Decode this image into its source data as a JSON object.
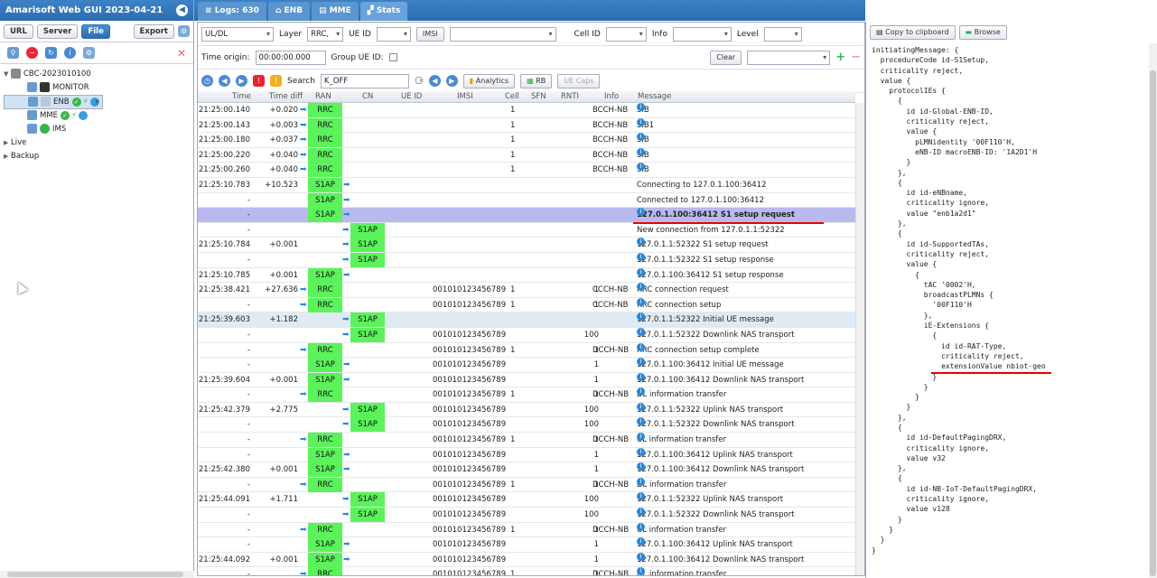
{
  "app": {
    "title": "Amarisoft Web GUI 2023-04-21"
  },
  "sidebar": {
    "buttons": [
      "URL",
      "Server",
      "File",
      "Export"
    ],
    "tree": {
      "root": "CBC-2023010100",
      "items": [
        {
          "label": "MONITOR"
        },
        {
          "label": "ENB"
        },
        {
          "label": "MME"
        },
        {
          "label": "IMS"
        }
      ],
      "live": "Live",
      "backup": "Backup"
    }
  },
  "tabs": [
    {
      "label": "Logs: 630"
    },
    {
      "label": "ENB"
    },
    {
      "label": "MME"
    },
    {
      "label": "Stats"
    }
  ],
  "filters": {
    "uldl": "UL/DL",
    "layer_label": "Layer",
    "layer_value": "RRC,",
    "ueid_label": "UE ID",
    "imsi_btn": "IMSI",
    "cellid_label": "Cell ID",
    "info_label": "Info",
    "level_label": "Level",
    "time_origin_label": "Time origin:",
    "time_origin_value": "00:00:00.000",
    "group_ueid_label": "Group UE ID:",
    "clear_label": "Clear",
    "search_label": "Search",
    "search_value": "K_OFF",
    "analytics_label": "Analytics",
    "rb_label": "RB",
    "uecaps_label": "UE Caps"
  },
  "table": {
    "headers": [
      "Time",
      "Time diff",
      "RAN",
      "CN",
      "UE ID",
      "IMSI",
      "Cell",
      "SFN",
      "RNTI",
      "Info",
      "Message"
    ],
    "rows": [
      {
        "time": "21:25:00.140",
        "diff": "+0.020",
        "ran": "RRC",
        "cn": "",
        "ueid": "",
        "imsi": "",
        "cell": "1",
        "info": "BCCH-NB",
        "msg": "SIB",
        "i": true
      },
      {
        "time": "21:25:00.143",
        "diff": "+0.003",
        "ran": "RRC",
        "cn": "",
        "ueid": "",
        "imsi": "",
        "cell": "1",
        "info": "BCCH-NB",
        "msg": "SIB1",
        "i": true
      },
      {
        "time": "21:25:00.180",
        "diff": "+0.037",
        "ran": "RRC",
        "cn": "",
        "ueid": "",
        "imsi": "",
        "cell": "1",
        "info": "BCCH-NB",
        "msg": "SIB",
        "i": true
      },
      {
        "time": "21:25:00.220",
        "diff": "+0.040",
        "ran": "RRC",
        "cn": "",
        "ueid": "",
        "imsi": "",
        "cell": "1",
        "info": "BCCH-NB",
        "msg": "SIB",
        "i": true
      },
      {
        "time": "21:25:00.260",
        "diff": "+0.040",
        "ran": "RRC",
        "cn": "",
        "ueid": "",
        "imsi": "",
        "cell": "1",
        "info": "BCCH-NB",
        "msg": "SIB",
        "i": true
      },
      {
        "time": "21:25:10.783",
        "diff": "+10.523",
        "ran": "S1AP",
        "cn": "",
        "ueid": "",
        "imsi": "",
        "cell": "",
        "info": "",
        "msg": "Connecting to 127.0.1.100:36412",
        "i": false
      },
      {
        "time": "-",
        "diff": "",
        "ran": "S1AP",
        "cn": "",
        "ueid": "",
        "imsi": "",
        "cell": "",
        "info": "",
        "msg": "Connected to 127.0.1.100:36412",
        "i": false
      },
      {
        "time": "-",
        "diff": "",
        "ran": "S1AP",
        "cn": "",
        "ueid": "",
        "imsi": "",
        "cell": "",
        "info": "",
        "msg": "127.0.1.100:36412 S1 setup request",
        "i": true,
        "hl": true
      },
      {
        "time": "-",
        "diff": "",
        "ran": "",
        "cn": "S1AP",
        "ueid": "",
        "imsi": "",
        "cell": "",
        "info": "",
        "msg": "New connection from 127.0.1.1:52322",
        "i": false
      },
      {
        "time": "21:25:10.784",
        "diff": "+0.001",
        "ran": "",
        "cn": "S1AP",
        "ueid": "",
        "imsi": "",
        "cell": "",
        "info": "",
        "msg": "127.0.1.1:52322 S1 setup request",
        "i": true
      },
      {
        "time": "-",
        "diff": "",
        "ran": "",
        "cn": "S1AP",
        "ueid": "",
        "imsi": "",
        "cell": "",
        "info": "",
        "msg": "127.0.1.1:52322 S1 setup response",
        "i": true
      },
      {
        "time": "21:25:10.785",
        "diff": "+0.001",
        "ran": "S1AP",
        "cn": "",
        "ueid": "",
        "imsi": "",
        "cell": "",
        "info": "",
        "msg": "127.0.1.100:36412 S1 setup response",
        "i": true
      },
      {
        "time": "21:25:38.421",
        "diff": "+27.636",
        "ran": "RRC",
        "cn": "",
        "ueid": "1",
        "imsi": "001010123456789",
        "cell": "1",
        "info": "CCCH-NB",
        "msg": "RRC connection request",
        "i": true
      },
      {
        "time": "-",
        "diff": "",
        "ran": "RRC",
        "cn": "",
        "ueid": "1",
        "imsi": "001010123456789",
        "cell": "1",
        "info": "CCCH-NB",
        "msg": "RRC connection setup",
        "i": true
      },
      {
        "time": "21:25:39.603",
        "diff": "+1.182",
        "ran": "",
        "cn": "S1AP",
        "ueid": "",
        "imsi": "",
        "cell": "",
        "info": "",
        "msg": "127.0.1.1:52322 Initial UE message",
        "i": true,
        "hl2": true
      },
      {
        "time": "-",
        "diff": "",
        "ran": "",
        "cn": "S1AP",
        "ueid": "100",
        "imsi": "001010123456789",
        "cell": "",
        "info": "",
        "msg": "127.0.1.1:52322 Downlink NAS transport",
        "i": true
      },
      {
        "time": "-",
        "diff": "",
        "ran": "RRC",
        "cn": "",
        "ueid": "1",
        "imsi": "001010123456789",
        "cell": "1",
        "info": "DCCH-NB",
        "msg": "RRC connection setup complete",
        "i": true
      },
      {
        "time": "-",
        "diff": "",
        "ran": "S1AP",
        "cn": "",
        "ueid": "1",
        "imsi": "001010123456789",
        "cell": "",
        "info": "",
        "msg": "127.0.1.100:36412 Initial UE message",
        "i": true
      },
      {
        "time": "21:25:39.604",
        "diff": "+0.001",
        "ran": "S1AP",
        "cn": "",
        "ueid": "1",
        "imsi": "001010123456789",
        "cell": "",
        "info": "",
        "msg": "127.0.1.100:36412 Downlink NAS transport",
        "i": true
      },
      {
        "time": "-",
        "diff": "",
        "ran": "RRC",
        "cn": "",
        "ueid": "1",
        "imsi": "001010123456789",
        "cell": "1",
        "info": "DCCH-NB",
        "msg": "DL information transfer",
        "i": true
      },
      {
        "time": "21:25:42.379",
        "diff": "+2.775",
        "ran": "",
        "cn": "S1AP",
        "ueid": "100",
        "imsi": "001010123456789",
        "cell": "",
        "info": "",
        "msg": "127.0.1.1:52322 Uplink NAS transport",
        "i": true
      },
      {
        "time": "-",
        "diff": "",
        "ran": "",
        "cn": "S1AP",
        "ueid": "100",
        "imsi": "001010123456789",
        "cell": "",
        "info": "",
        "msg": "127.0.1.1:52322 Downlink NAS transport",
        "i": true
      },
      {
        "time": "-",
        "diff": "",
        "ran": "RRC",
        "cn": "",
        "ueid": "1",
        "imsi": "001010123456789",
        "cell": "1",
        "info": "DCCH-NB",
        "msg": "UL information transfer",
        "i": true
      },
      {
        "time": "-",
        "diff": "",
        "ran": "S1AP",
        "cn": "",
        "ueid": "1",
        "imsi": "001010123456789",
        "cell": "",
        "info": "",
        "msg": "127.0.1.100:36412 Uplink NAS transport",
        "i": true
      },
      {
        "time": "21:25:42.380",
        "diff": "+0.001",
        "ran": "S1AP",
        "cn": "",
        "ueid": "1",
        "imsi": "001010123456789",
        "cell": "",
        "info": "",
        "msg": "127.0.1.100:36412 Downlink NAS transport",
        "i": true
      },
      {
        "time": "-",
        "diff": "",
        "ran": "RRC",
        "cn": "",
        "ueid": "1",
        "imsi": "001010123456789",
        "cell": "1",
        "info": "DCCH-NB",
        "msg": "DL information transfer",
        "i": true
      },
      {
        "time": "21:25:44.091",
        "diff": "+1.711",
        "ran": "",
        "cn": "S1AP",
        "ueid": "100",
        "imsi": "001010123456789",
        "cell": "",
        "info": "",
        "msg": "127.0.1.1:52322 Uplink NAS transport",
        "i": true
      },
      {
        "time": "-",
        "diff": "",
        "ran": "",
        "cn": "S1AP",
        "ueid": "100",
        "imsi": "001010123456789",
        "cell": "",
        "info": "",
        "msg": "127.0.1.1:52322 Downlink NAS transport",
        "i": true
      },
      {
        "time": "-",
        "diff": "",
        "ran": "RRC",
        "cn": "",
        "ueid": "1",
        "imsi": "001010123456789",
        "cell": "1",
        "info": "DCCH-NB",
        "msg": "UL information transfer",
        "i": true
      },
      {
        "time": "-",
        "diff": "",
        "ran": "S1AP",
        "cn": "",
        "ueid": "1",
        "imsi": "001010123456789",
        "cell": "",
        "info": "",
        "msg": "127.0.1.100:36412 Uplink NAS transport",
        "i": true
      },
      {
        "time": "21:25:44.092",
        "diff": "+0.001",
        "ran": "S1AP",
        "cn": "",
        "ueid": "1",
        "imsi": "001010123456789",
        "cell": "",
        "info": "",
        "msg": "127.0.1.100:36412 Downlink NAS transport",
        "i": true
      },
      {
        "time": "-",
        "diff": "",
        "ran": "RRC",
        "cn": "",
        "ueid": "1",
        "imsi": "001010123456789",
        "cell": "1",
        "info": "DCCH-NB",
        "msg": "DL information transfer",
        "i": true
      }
    ]
  },
  "right": {
    "copy_label": "Copy to clipboard",
    "browse_label": "Browse",
    "code": "initiatingMessage: {\n  procedureCode id-S1Setup,\n  criticality reject,\n  value {\n    protocolIEs {\n      {\n        id id-Global-ENB-ID,\n        criticality reject,\n        value {\n          pLMNidentity '00F110'H,\n          eNB-ID macroENB-ID: '1A2D1'H\n        }\n      },\n      {\n        id id-eNBname,\n        criticality ignore,\n        value \"enb1a2d1\"\n      },\n      {\n        id id-SupportedTAs,\n        criticality reject,\n        value {\n          {\n            tAC '0002'H,\n            broadcastPLMNs {\n              '00F110'H\n            },\n            iE-Extensions {\n              {\n                id id-RAT-Type,\n                criticality reject,\n                extensionValue nbiot-geo\n              }\n            }\n          }\n        }\n      },\n      {\n        id id-DefaultPagingDRX,\n        criticality ignore,\n        value v32\n      },\n      {\n        id id-NB-IoT-DefaultPagingDRX,\n        criticality ignore,\n        value v128\n      }\n    }\n  }\n}"
  }
}
